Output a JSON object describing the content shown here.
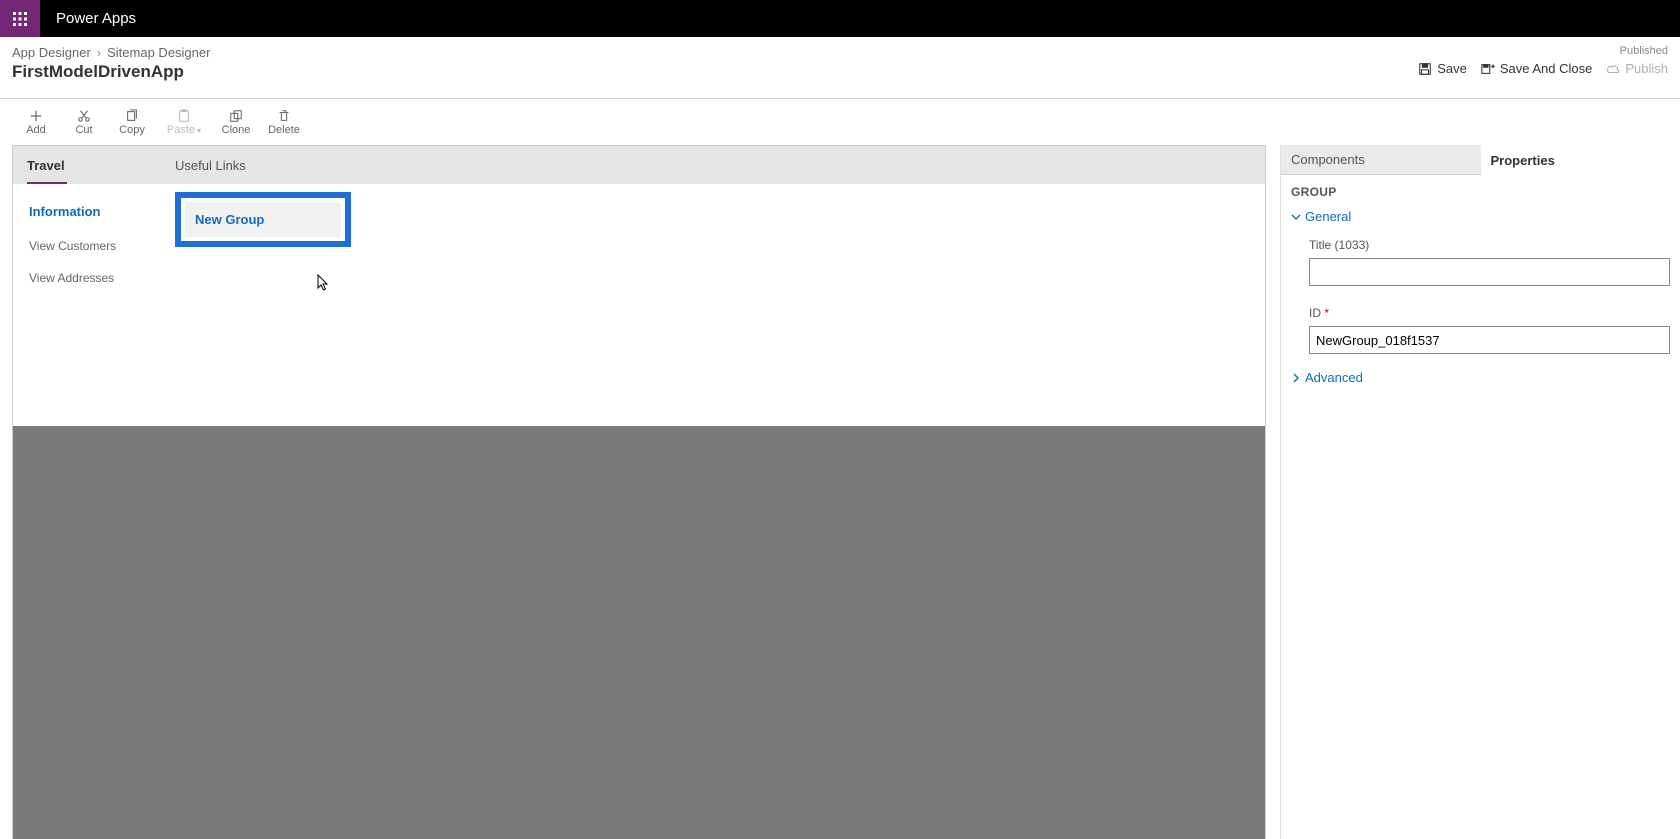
{
  "topbar": {
    "product": "Power Apps"
  },
  "breadcrumb": {
    "item1": "App Designer",
    "item2": "Sitemap Designer"
  },
  "app_title": "FirstModelDrivenApp",
  "status": "Published",
  "header_actions": {
    "save": "Save",
    "save_close": "Save And Close",
    "publish": "Publish"
  },
  "toolbar": {
    "add": "Add",
    "cut": "Cut",
    "copy": "Copy",
    "paste": "Paste",
    "clone": "Clone",
    "delete": "Delete"
  },
  "sitemap": {
    "areas": [
      {
        "label": "Travel"
      },
      {
        "label": "Useful Links"
      }
    ],
    "travel_group": {
      "header": "Information",
      "items": [
        "View Customers",
        "View Addresses"
      ]
    },
    "useful_links_group": {
      "selected_label": "New Group"
    }
  },
  "right_panel": {
    "tabs": {
      "components": "Components",
      "properties": "Properties"
    },
    "section_title": "GROUP",
    "general_label": "General",
    "title_field_label": "Title (1033)",
    "title_value": "",
    "id_field_label": "ID",
    "id_value": "NewGroup_018f1537",
    "advanced_label": "Advanced"
  }
}
